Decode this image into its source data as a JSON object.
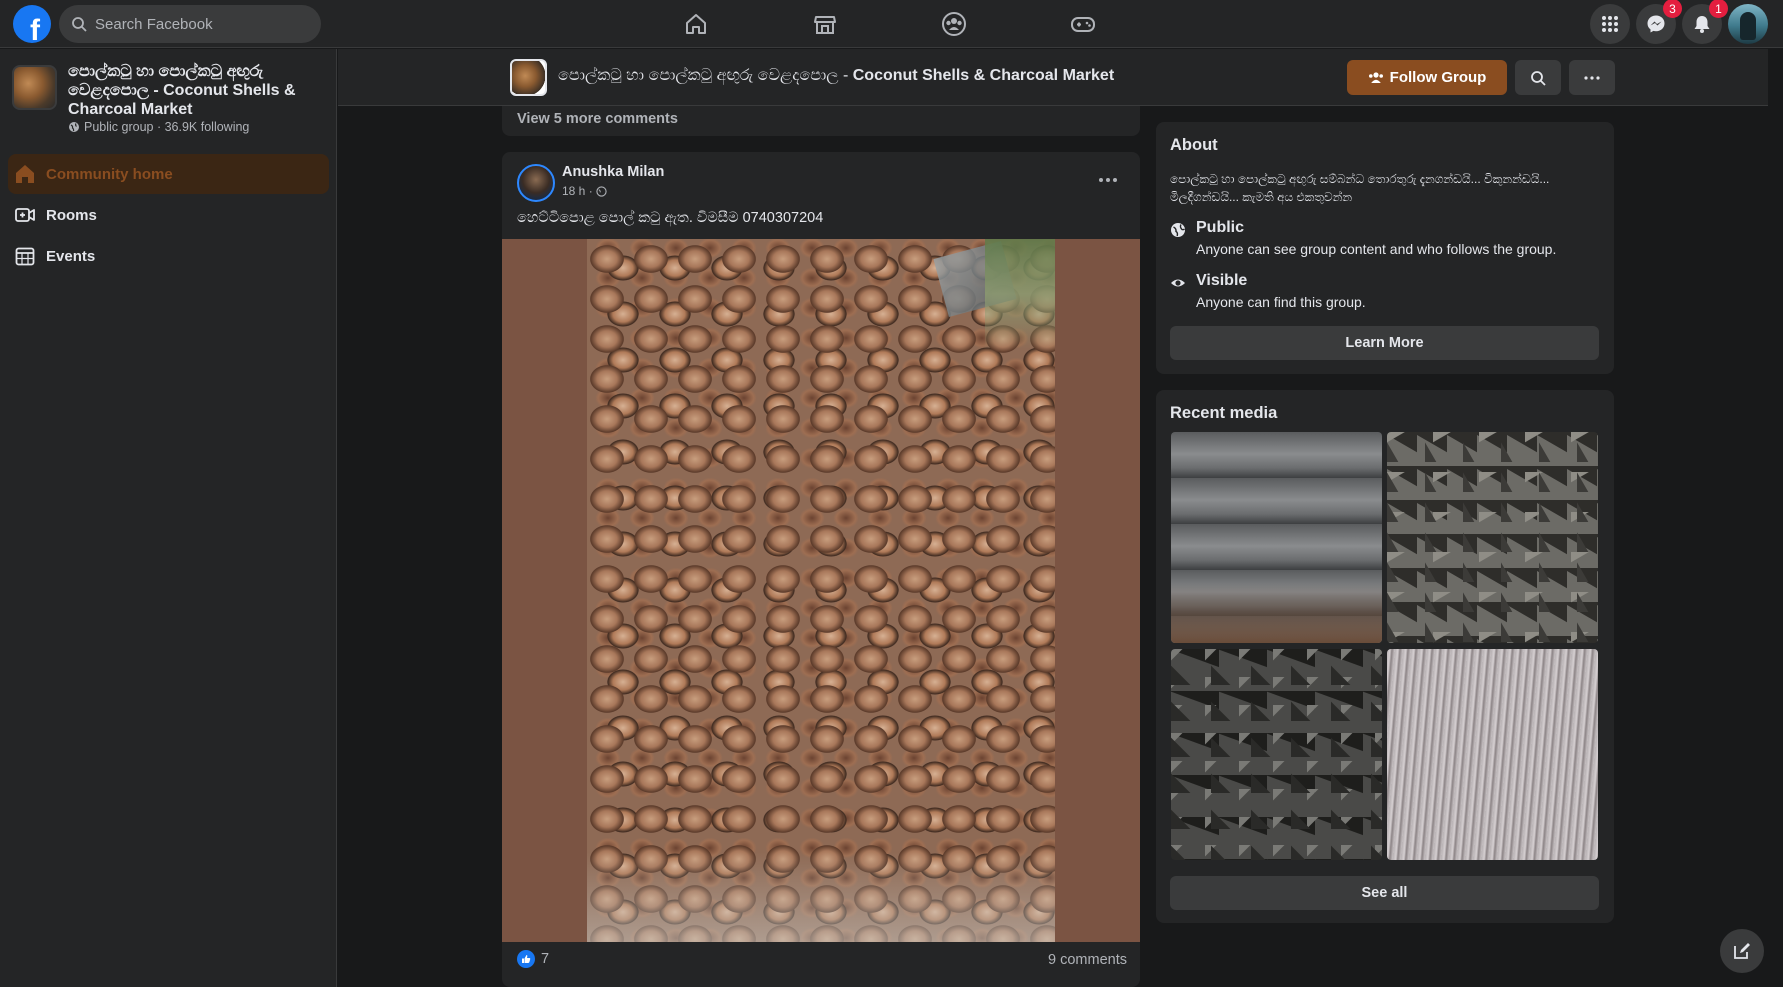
{
  "topbar": {
    "search_placeholder": "Search Facebook",
    "nav_icons": [
      "home-icon",
      "marketplace-icon",
      "groups-icon",
      "gaming-icon"
    ],
    "messenger_badge": "3",
    "notifications_badge": "1"
  },
  "sidebar": {
    "group_name": "පොල්කටු හා පොල්කටු අඟුරු වෙළදපොල - Coconut Shells & Charcoal Market",
    "group_meta": "Public group · 36.9K following",
    "items": [
      {
        "label": "Community home",
        "icon": "home-icon"
      },
      {
        "label": "Rooms",
        "icon": "video-room-icon"
      },
      {
        "label": "Events",
        "icon": "calendar-icon"
      }
    ]
  },
  "group_header": {
    "title_prefix": "පොල්කටු හා පොල්කටු අඟුරු වෙළදපොල - ",
    "title_bold": "Coconut Shells & Charcoal Market",
    "follow_label": "Follow Group"
  },
  "feed": {
    "view_more_comments": "View 5 more comments",
    "post": {
      "author": "Anushka Milan",
      "time": "18 h ·",
      "text": "හෙට්ටිපොළ පොල් කටු ඇත. විමසීම 0740307204",
      "likes": "7",
      "comments": "9 comments"
    }
  },
  "about": {
    "title": "About",
    "description": "පොල්කටු හා පොල්කටු අඟුරු සම්බන්ධ තොරතුරු දැනගන්ඩයි... විකුනන්ඩයි... මිලදීගන්ඩයි... කැමති අය එකතුවන්න",
    "public_title": "Public",
    "public_desc": "Anyone can see group content and who follows the group.",
    "visible_title": "Visible",
    "visible_desc": "Anyone can find this group.",
    "learn_more": "Learn More"
  },
  "recent_media": {
    "title": "Recent media",
    "see_all": "See all"
  },
  "colors": {
    "accent": "#8a4d20",
    "fb_blue": "#1877f2",
    "badge_red": "#e41e3f"
  }
}
